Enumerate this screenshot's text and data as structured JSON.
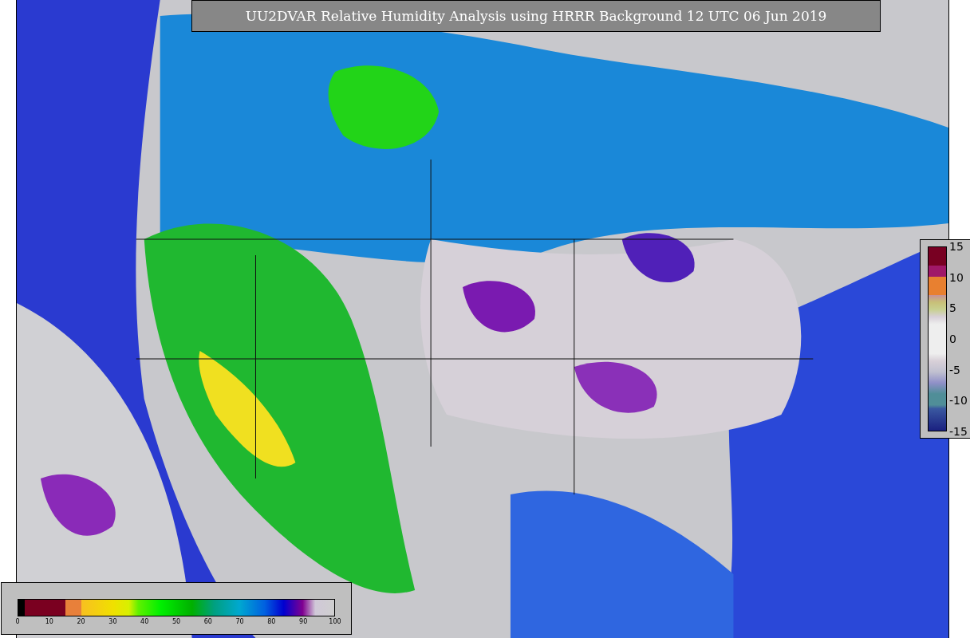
{
  "title": "UU2DVAR Relative Humidity Analysis using HRRR Background 12 UTC 06 Jun 2019",
  "humidity_colorbar": {
    "ticks": [
      "0",
      "10",
      "20",
      "30",
      "40",
      "50",
      "60",
      "70",
      "80",
      "90",
      "100"
    ]
  },
  "increment_colorbar": {
    "ticks": [
      "15",
      "10",
      "5",
      "0",
      "-5",
      "-10",
      "-15"
    ]
  }
}
